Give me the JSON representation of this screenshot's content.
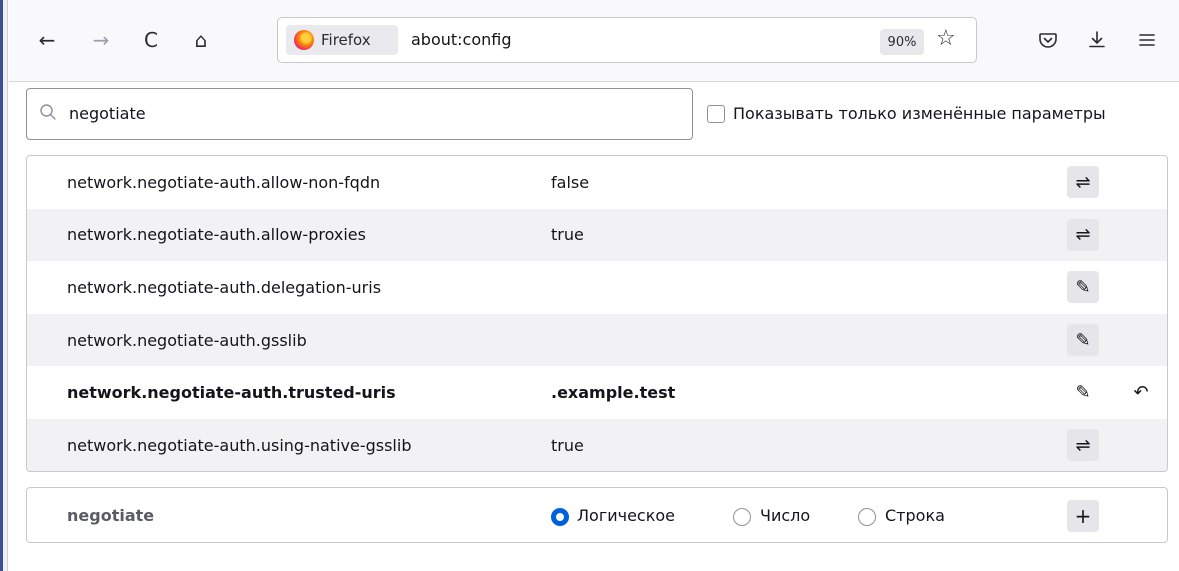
{
  "toolbar": {
    "back": "←",
    "forward": "→",
    "reload": "C",
    "home": "⌂",
    "identity_label": "Firefox",
    "url": "about:config",
    "zoom": "90%",
    "bookmark_star": "☆",
    "pocket": "◡",
    "downloads": "⤓",
    "menu": "≡"
  },
  "search": {
    "value": "negotiate",
    "show_modified_label": "Показывать только изменённые параметры",
    "show_modified_checked": false
  },
  "prefs": [
    {
      "name": "network.negotiate-auth.allow-non-fqdn",
      "value": "false",
      "action": "toggle",
      "modified": false
    },
    {
      "name": "network.negotiate-auth.allow-proxies",
      "value": "true",
      "action": "toggle",
      "modified": false
    },
    {
      "name": "network.negotiate-auth.delegation-uris",
      "value": "",
      "action": "edit",
      "modified": false
    },
    {
      "name": "network.negotiate-auth.gsslib",
      "value": "",
      "action": "edit",
      "modified": false
    },
    {
      "name": "network.negotiate-auth.trusted-uris",
      "value": ".example.test",
      "action": "edit",
      "modified": true
    },
    {
      "name": "network.negotiate-auth.using-native-gsslib",
      "value": "true",
      "action": "toggle",
      "modified": false
    }
  ],
  "icons": {
    "toggle": "⇌",
    "edit": "✎",
    "reset": "↶",
    "add": "+"
  },
  "add_row": {
    "name": "negotiate",
    "types": [
      {
        "label": "Логическое",
        "checked": true
      },
      {
        "label": "Число",
        "checked": false
      },
      {
        "label": "Строка",
        "checked": false
      }
    ]
  },
  "colors": {
    "accent": "#0061e0",
    "alt_row": "#f2f2f4"
  }
}
